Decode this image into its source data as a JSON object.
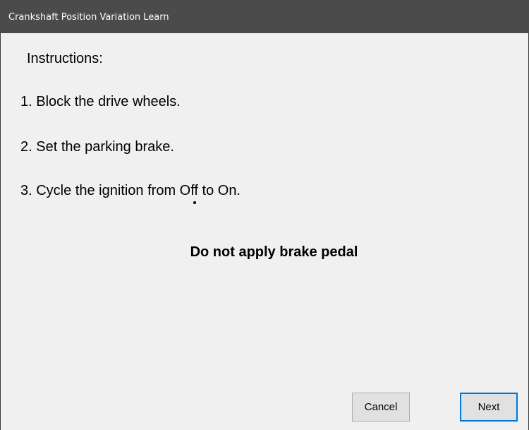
{
  "window": {
    "title": "Crankshaft Position Variation Learn"
  },
  "instructions": {
    "heading": "Instructions:",
    "steps": [
      "1. Block the drive wheels.",
      "2. Set the parking brake.",
      "3. Cycle the ignition from Off to On."
    ],
    "warning": "Do not apply brake pedal"
  },
  "buttons": {
    "cancel_label": "Cancel",
    "next_label": "Next"
  },
  "colors": {
    "titlebar": "#4b4b4b",
    "background": "#f0f0f0",
    "focus_border": "#0078d7"
  }
}
